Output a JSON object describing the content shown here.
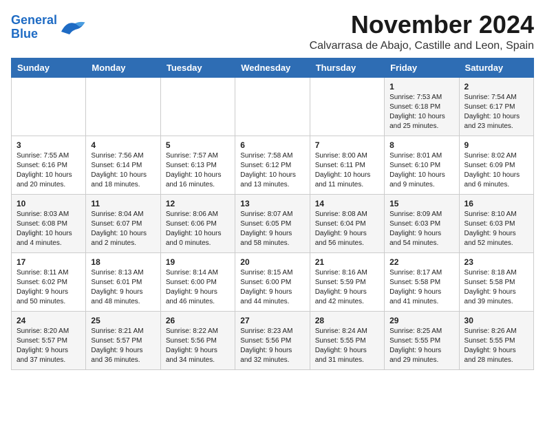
{
  "header": {
    "logo_line1": "General",
    "logo_line2": "Blue",
    "title": "November 2024",
    "subtitle": "Calvarrasa de Abajo, Castille and Leon, Spain"
  },
  "weekdays": [
    "Sunday",
    "Monday",
    "Tuesday",
    "Wednesday",
    "Thursday",
    "Friday",
    "Saturday"
  ],
  "weeks": [
    [
      {
        "day": "",
        "info": ""
      },
      {
        "day": "",
        "info": ""
      },
      {
        "day": "",
        "info": ""
      },
      {
        "day": "",
        "info": ""
      },
      {
        "day": "",
        "info": ""
      },
      {
        "day": "1",
        "info": "Sunrise: 7:53 AM\nSunset: 6:18 PM\nDaylight: 10 hours and 25 minutes."
      },
      {
        "day": "2",
        "info": "Sunrise: 7:54 AM\nSunset: 6:17 PM\nDaylight: 10 hours and 23 minutes."
      }
    ],
    [
      {
        "day": "3",
        "info": "Sunrise: 7:55 AM\nSunset: 6:16 PM\nDaylight: 10 hours and 20 minutes."
      },
      {
        "day": "4",
        "info": "Sunrise: 7:56 AM\nSunset: 6:14 PM\nDaylight: 10 hours and 18 minutes."
      },
      {
        "day": "5",
        "info": "Sunrise: 7:57 AM\nSunset: 6:13 PM\nDaylight: 10 hours and 16 minutes."
      },
      {
        "day": "6",
        "info": "Sunrise: 7:58 AM\nSunset: 6:12 PM\nDaylight: 10 hours and 13 minutes."
      },
      {
        "day": "7",
        "info": "Sunrise: 8:00 AM\nSunset: 6:11 PM\nDaylight: 10 hours and 11 minutes."
      },
      {
        "day": "8",
        "info": "Sunrise: 8:01 AM\nSunset: 6:10 PM\nDaylight: 10 hours and 9 minutes."
      },
      {
        "day": "9",
        "info": "Sunrise: 8:02 AM\nSunset: 6:09 PM\nDaylight: 10 hours and 6 minutes."
      }
    ],
    [
      {
        "day": "10",
        "info": "Sunrise: 8:03 AM\nSunset: 6:08 PM\nDaylight: 10 hours and 4 minutes."
      },
      {
        "day": "11",
        "info": "Sunrise: 8:04 AM\nSunset: 6:07 PM\nDaylight: 10 hours and 2 minutes."
      },
      {
        "day": "12",
        "info": "Sunrise: 8:06 AM\nSunset: 6:06 PM\nDaylight: 10 hours and 0 minutes."
      },
      {
        "day": "13",
        "info": "Sunrise: 8:07 AM\nSunset: 6:05 PM\nDaylight: 9 hours and 58 minutes."
      },
      {
        "day": "14",
        "info": "Sunrise: 8:08 AM\nSunset: 6:04 PM\nDaylight: 9 hours and 56 minutes."
      },
      {
        "day": "15",
        "info": "Sunrise: 8:09 AM\nSunset: 6:03 PM\nDaylight: 9 hours and 54 minutes."
      },
      {
        "day": "16",
        "info": "Sunrise: 8:10 AM\nSunset: 6:03 PM\nDaylight: 9 hours and 52 minutes."
      }
    ],
    [
      {
        "day": "17",
        "info": "Sunrise: 8:11 AM\nSunset: 6:02 PM\nDaylight: 9 hours and 50 minutes."
      },
      {
        "day": "18",
        "info": "Sunrise: 8:13 AM\nSunset: 6:01 PM\nDaylight: 9 hours and 48 minutes."
      },
      {
        "day": "19",
        "info": "Sunrise: 8:14 AM\nSunset: 6:00 PM\nDaylight: 9 hours and 46 minutes."
      },
      {
        "day": "20",
        "info": "Sunrise: 8:15 AM\nSunset: 6:00 PM\nDaylight: 9 hours and 44 minutes."
      },
      {
        "day": "21",
        "info": "Sunrise: 8:16 AM\nSunset: 5:59 PM\nDaylight: 9 hours and 42 minutes."
      },
      {
        "day": "22",
        "info": "Sunrise: 8:17 AM\nSunset: 5:58 PM\nDaylight: 9 hours and 41 minutes."
      },
      {
        "day": "23",
        "info": "Sunrise: 8:18 AM\nSunset: 5:58 PM\nDaylight: 9 hours and 39 minutes."
      }
    ],
    [
      {
        "day": "24",
        "info": "Sunrise: 8:20 AM\nSunset: 5:57 PM\nDaylight: 9 hours and 37 minutes."
      },
      {
        "day": "25",
        "info": "Sunrise: 8:21 AM\nSunset: 5:57 PM\nDaylight: 9 hours and 36 minutes."
      },
      {
        "day": "26",
        "info": "Sunrise: 8:22 AM\nSunset: 5:56 PM\nDaylight: 9 hours and 34 minutes."
      },
      {
        "day": "27",
        "info": "Sunrise: 8:23 AM\nSunset: 5:56 PM\nDaylight: 9 hours and 32 minutes."
      },
      {
        "day": "28",
        "info": "Sunrise: 8:24 AM\nSunset: 5:55 PM\nDaylight: 9 hours and 31 minutes."
      },
      {
        "day": "29",
        "info": "Sunrise: 8:25 AM\nSunset: 5:55 PM\nDaylight: 9 hours and 29 minutes."
      },
      {
        "day": "30",
        "info": "Sunrise: 8:26 AM\nSunset: 5:55 PM\nDaylight: 9 hours and 28 minutes."
      }
    ]
  ]
}
